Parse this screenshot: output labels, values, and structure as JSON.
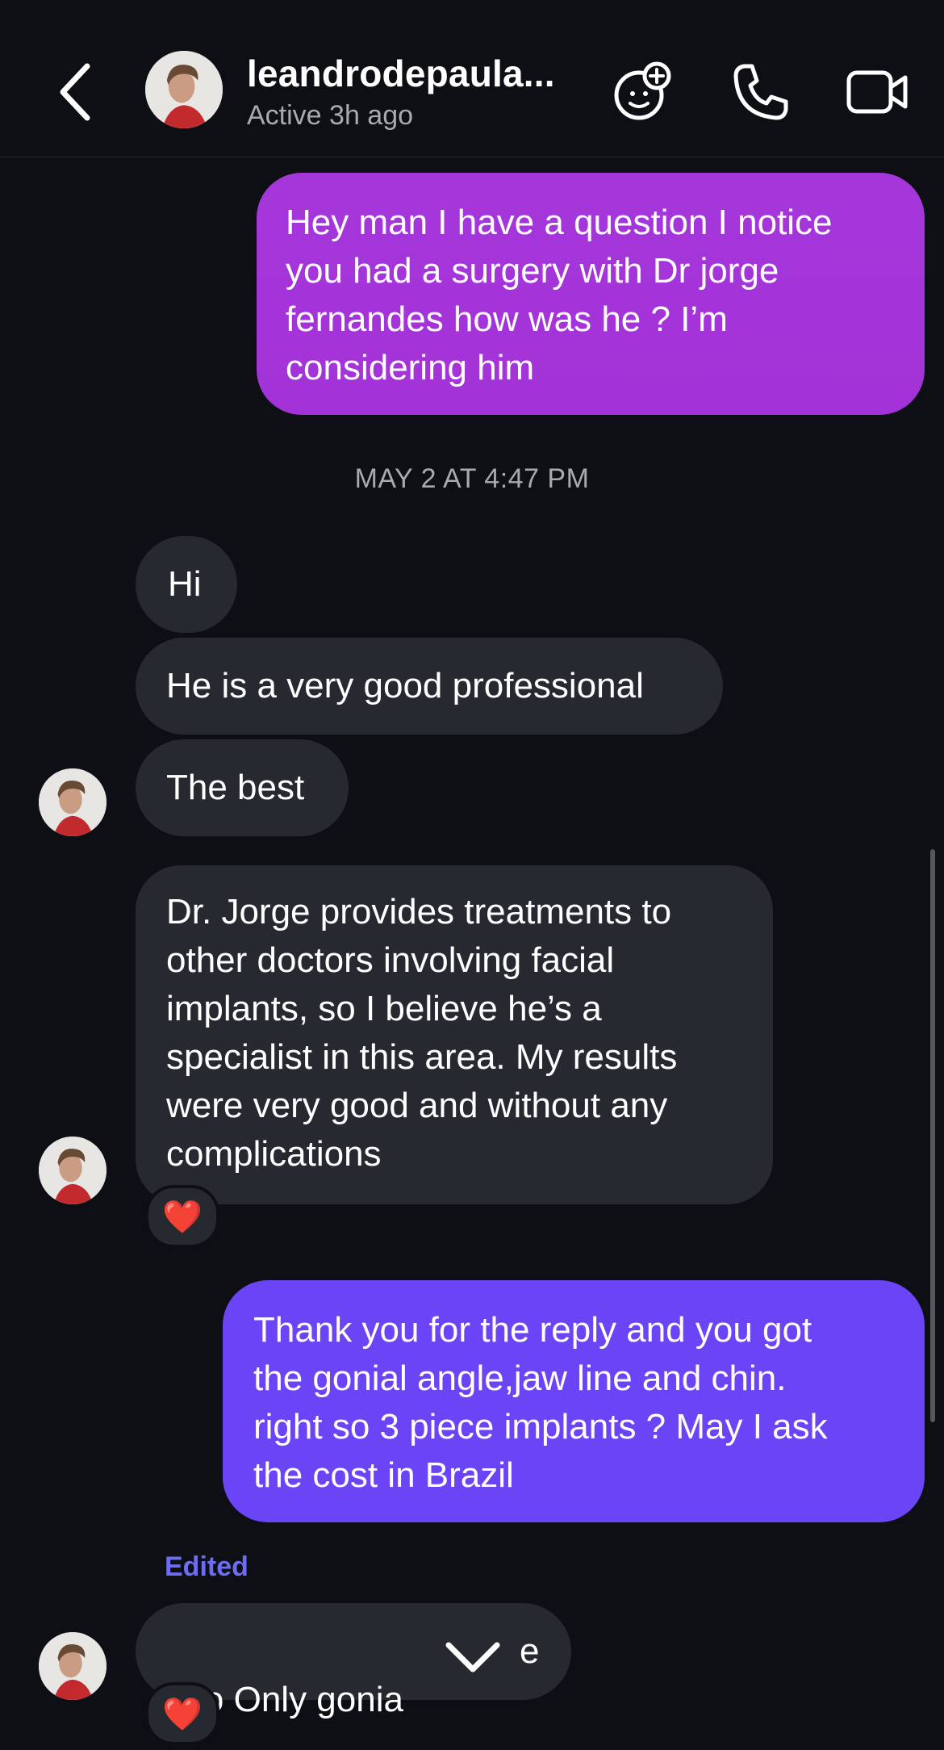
{
  "header": {
    "username": "leandrodepaula...",
    "status": "Active 3h ago",
    "icons": [
      "back-chevron-icon",
      "avatar-face-add-icon",
      "phone-icon",
      "video-camera-icon"
    ]
  },
  "messages": [
    {
      "type": "sent",
      "text": "Hey man I have a question I notice\nyou had a surgery with Dr jorge\nfernandes how was he ? I’m\nconsidering him"
    },
    {
      "type": "recv",
      "text": "Hi"
    },
    {
      "type": "recv",
      "text": "He is a very good professional"
    },
    {
      "type": "recv",
      "text": "The best"
    },
    {
      "type": "recv",
      "text": "Dr. Jorge provides treatments to\nother doctors involving facial\nimplants, so I believe he’s a\nspecialist in this area. My results\nwere very good and without any\ncomplications"
    },
    {
      "type": "sent",
      "text": "Thank you for the reply and you got\nthe gonial angle,jaw line and chin.\nright so 3 piece implants ? May I ask\nthe cost in Brazil"
    },
    {
      "type": "recv",
      "text_left": "I do Only gonia",
      "text_right": "e"
    }
  ],
  "timestamp": "MAY 2 AT 4:47 PM",
  "edited_label": "Edited",
  "reactions": [
    "❤️",
    "❤️"
  ],
  "colors": {
    "background": "#0d0f14",
    "received_bubble": "#262a30",
    "sent_bubble_purple": "#a536da",
    "sent_bubble_violet": "#6a44f5",
    "edited_label": "#6d6cf2"
  }
}
